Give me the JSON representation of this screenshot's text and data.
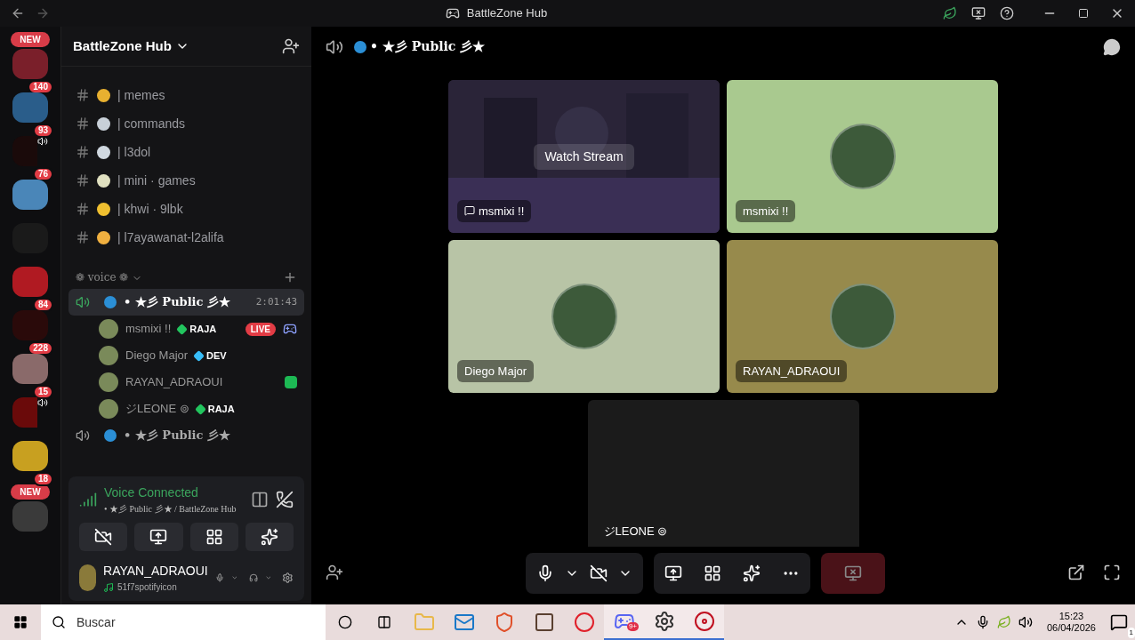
{
  "title_bar": {
    "title": "BattleZone Hub"
  },
  "servers": [
    {
      "color": "#7a1f2a",
      "badge": "NEW",
      "count": "140"
    },
    {
      "color": "#2a5d8a",
      "count": "93"
    },
    {
      "color": "#1a0a0a",
      "count": "76",
      "speaker": true
    },
    {
      "color": "#4a86b8"
    },
    {
      "color": "#1a1a1a"
    },
    {
      "color": "#b01a22",
      "count": "84"
    },
    {
      "color": "#2a0a0a",
      "count": "228"
    },
    {
      "color": "#8a6a6a",
      "count": "15"
    },
    {
      "color": "#6a0a0a",
      "speaker": true
    },
    {
      "color": "#c8a020",
      "count": "18"
    },
    {
      "color": "#3a3a3a",
      "badge": "NEW"
    }
  ],
  "sidebar": {
    "server_name": "BattleZone Hub",
    "text_channels": [
      {
        "name": "| memes",
        "color": "#e8b030"
      },
      {
        "name": "| commands",
        "color": "#c8d0d8"
      },
      {
        "name": "| l3dol",
        "color": "#d0d8e0"
      },
      {
        "name": "| mini · games",
        "color": "#e0e0c0"
      },
      {
        "name": "| khwi · 9lbk",
        "color": "#f0c030"
      },
      {
        "name": "| l7ayawanat-l2alifa",
        "color": "#f0b040"
      }
    ],
    "voice_category": "❁ voice ❁",
    "voice_channels": [
      {
        "name": "• ★彡 Public 彡★",
        "selected": true,
        "timer": "2:01:43",
        "members": [
          {
            "name": "msmixi !!",
            "tag": "RAJA",
            "color": "#22c55e",
            "live": "LIVE",
            "kind": "streaming"
          },
          {
            "name": "Diego Major",
            "tag": "DEV",
            "color": "#38bdf8",
            "kind": "plain"
          },
          {
            "name": "RAYAN_ADRAOUI",
            "kind": "spotify"
          },
          {
            "name": "ジLEONE ⊚",
            "tag": "RAJA",
            "color": "#22c55e",
            "kind": "plain"
          }
        ]
      },
      {
        "name": "• ★彡 Public 彡★",
        "selected": false
      }
    ]
  },
  "voice_panel": {
    "status": "Voice Connected",
    "detail": "• ★彡 Public 彡★ / BattleZone Hub"
  },
  "user": {
    "name": "RAYAN_ADRAOUI",
    "activity": "51f7spotifyicon"
  },
  "main": {
    "channel": "• ★彡 Public 彡★",
    "tiles": [
      {
        "name": "msmixi !!",
        "kind": "stream",
        "color": "#2a2438",
        "action": "Watch Stream"
      },
      {
        "name": "msmixi !!",
        "kind": "avatar",
        "color": "#a9c98f"
      },
      {
        "name": "Diego Major",
        "kind": "avatar",
        "color": "#b8c4a6"
      },
      {
        "name": "RAYAN_ADRAOUI",
        "kind": "avatar",
        "color": "#978a4c"
      },
      {
        "name": "ジLEONE ⊚",
        "kind": "dark",
        "color": "#1b1b1b"
      }
    ]
  },
  "taskbar": {
    "search": {
      "placeholder": "Buscar"
    },
    "apps": [
      {
        "kind": "files",
        "active": false
      },
      {
        "kind": "mail",
        "active": false
      },
      {
        "kind": "brave",
        "active": false
      },
      {
        "kind": "game",
        "active": false
      },
      {
        "kind": "opera",
        "active": false
      },
      {
        "kind": "discord",
        "active": true,
        "badge": "9+"
      },
      {
        "kind": "settings",
        "active": true
      },
      {
        "kind": "media",
        "active": true
      }
    ],
    "time": "15:23",
    "date": "06/04/2026",
    "notifications": "1"
  }
}
